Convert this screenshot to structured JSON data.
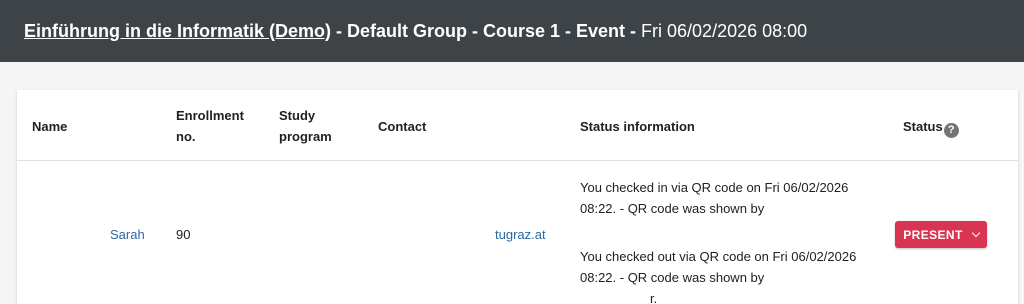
{
  "header": {
    "course_link": "Einführung in die Informatik (Demo)",
    "title_rest": " - Default Group - Course 1 - Event - ",
    "date": "Fri 06/02/2026 08:00"
  },
  "table": {
    "columns": {
      "name": "Name",
      "enrollment_line1": "Enrollment",
      "enrollment_line2": "no.",
      "study_line1": "Study",
      "study_line2": "program",
      "contact": "Contact",
      "status_information": "Status information",
      "status": "Status"
    },
    "rows": [
      {
        "name": "Sarah",
        "enrollment_no": "90",
        "contact": "tugraz.at",
        "status_info": {
          "line1": "You checked in via QR code on Fri 06/02/2026",
          "line2": "08:22. - QR code was shown by",
          "line3": "You checked out via QR code on Fri 06/02/2026",
          "line4": "08:22. - QR code was shown by",
          "line5": "r."
        },
        "status": "PRESENT"
      }
    ]
  },
  "icons": {
    "help": "help-icon",
    "dropdown": "chevron-down-icon"
  },
  "colors": {
    "header_bg": "#3d4346",
    "status_present": "#d93452",
    "link": "#2a6aa0"
  }
}
